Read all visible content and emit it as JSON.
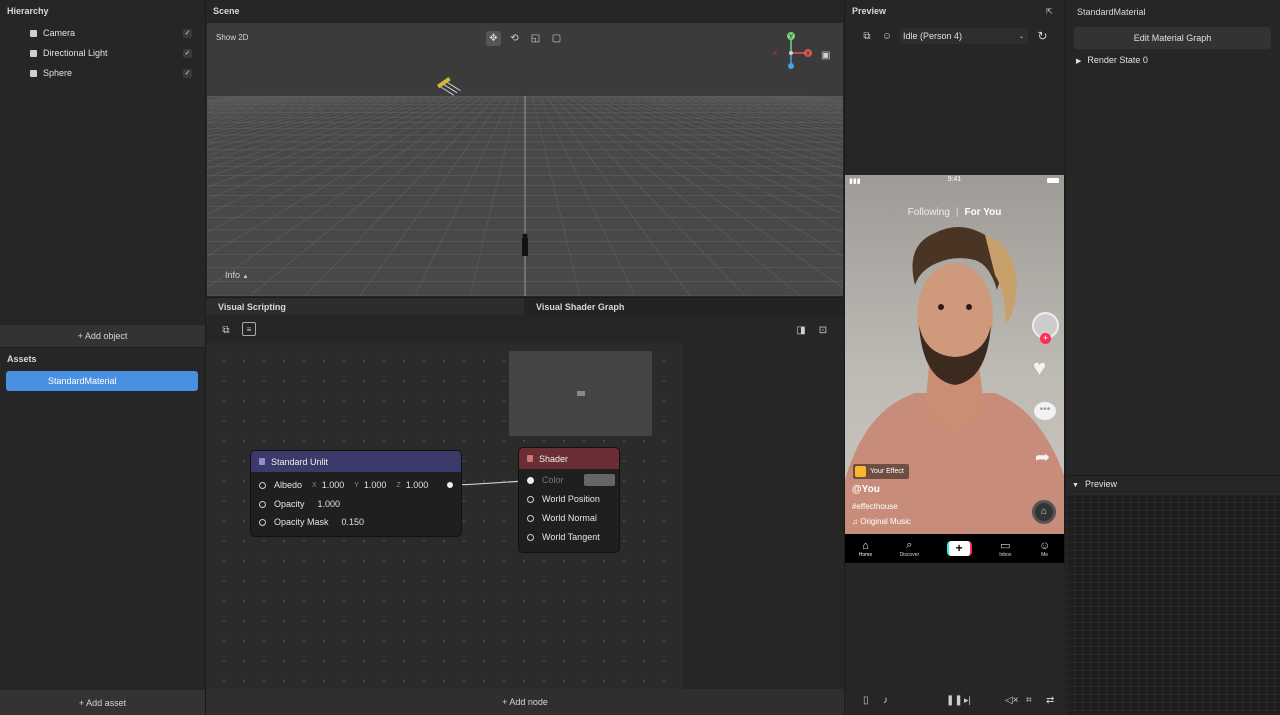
{
  "hierarchy": {
    "title": "Hierarchy",
    "items": [
      {
        "label": "Camera",
        "checked": true
      },
      {
        "label": "Directional Light",
        "checked": true
      },
      {
        "label": "Sphere",
        "checked": true
      }
    ],
    "add_label": "+ Add object"
  },
  "assets": {
    "title": "Assets",
    "items": [
      {
        "label": "StandardMaterial",
        "selected": true
      }
    ],
    "add_label": "+ Add asset"
  },
  "scene": {
    "title": "Scene",
    "show2d_label": "Show 2D",
    "info_label": "Info",
    "tools": [
      "move-tool-icon",
      "rotate-tool-icon",
      "scale-tool-icon",
      "rect-tool-icon"
    ],
    "gizmo": {
      "y": "Y",
      "x": "X"
    }
  },
  "tabs": [
    {
      "label": "Visual Scripting"
    },
    {
      "label": "Visual Shader Graph"
    }
  ],
  "graph": {
    "add_node_label": "+ Add node",
    "standard_unlit": {
      "title": "Standard Unlit",
      "albedo": {
        "label": "Albedo",
        "x_label": "X",
        "x": "1.000",
        "y_label": "Y",
        "y": "1.000",
        "z_label": "Z",
        "z": "1.000"
      },
      "opacity": {
        "label": "Opacity",
        "value": "1.000"
      },
      "opacity_mask": {
        "label": "Opacity Mask",
        "value": "0.150"
      }
    },
    "shader": {
      "title": "Shader",
      "inputs": [
        "Color",
        "World Position",
        "World Normal",
        "World Tangent"
      ]
    }
  },
  "preview": {
    "title": "Preview",
    "person_select": "Idle (Person 4)",
    "phone": {
      "time": "9:41",
      "following": "Following",
      "for_you": "For You",
      "effect_badge": "Your Effect",
      "username": "@You",
      "hashtag": "#effecthouse",
      "music": "Original Music",
      "nav": [
        "Home",
        "Discover",
        "+",
        "Inbox",
        "Me"
      ]
    }
  },
  "properties": {
    "title": "StandardMaterial",
    "edit_button": "Edit Material Graph",
    "render_state": "Render State 0",
    "preview_title": "Preview"
  },
  "colors": {
    "accent": "#4a90e2",
    "unlit_header": "#3b3a6b",
    "shader_header": "#6b2e34"
  }
}
